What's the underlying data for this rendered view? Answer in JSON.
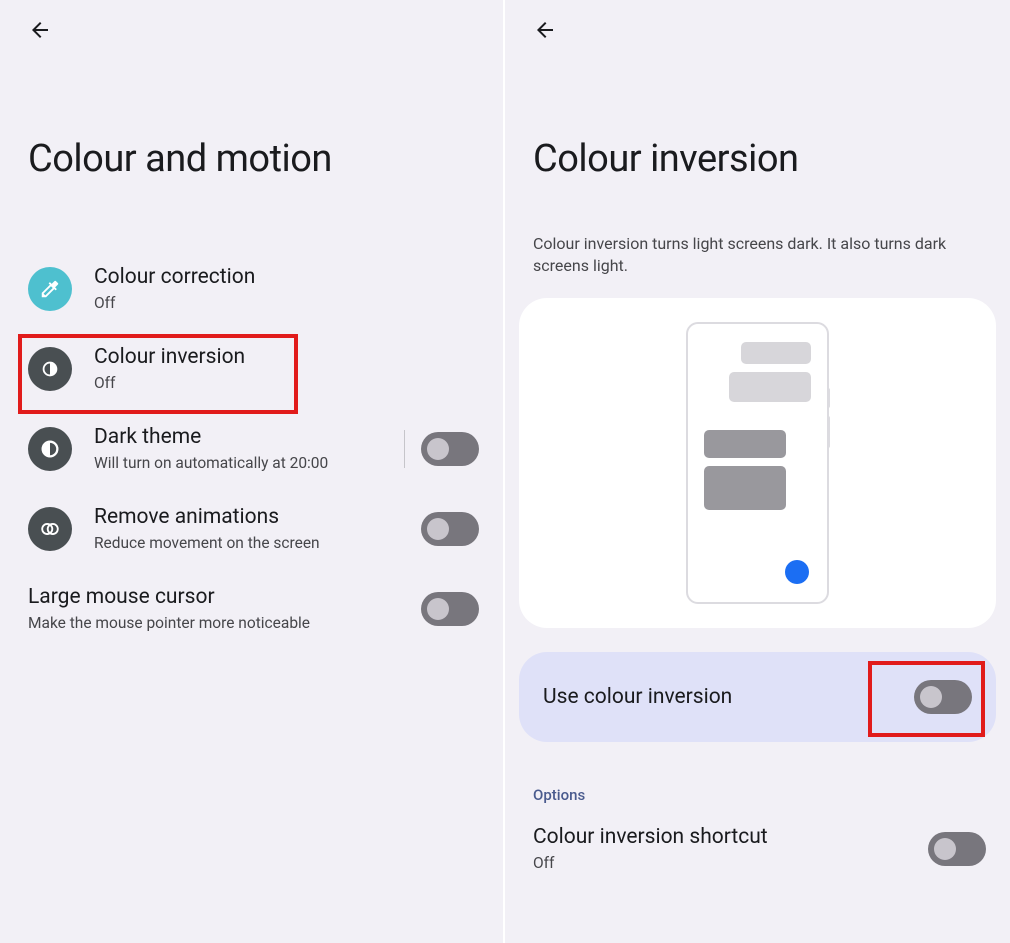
{
  "left": {
    "title": "Colour and motion",
    "items": [
      {
        "title": "Colour correction",
        "sub": "Off"
      },
      {
        "title": "Colour inversion",
        "sub": "Off"
      },
      {
        "title": "Dark theme",
        "sub": "Will turn on automatically at 20:00"
      },
      {
        "title": "Remove animations",
        "sub": "Reduce movement on the screen"
      },
      {
        "title": "Large mouse cursor",
        "sub": "Make the mouse pointer more noticeable"
      }
    ]
  },
  "right": {
    "title": "Colour inversion",
    "description": "Colour inversion turns light screens dark. It also turns dark screens light.",
    "toggle_label": "Use colour inversion",
    "options_header": "Options",
    "shortcut": {
      "title": "Colour inversion shortcut",
      "sub": "Off"
    }
  }
}
